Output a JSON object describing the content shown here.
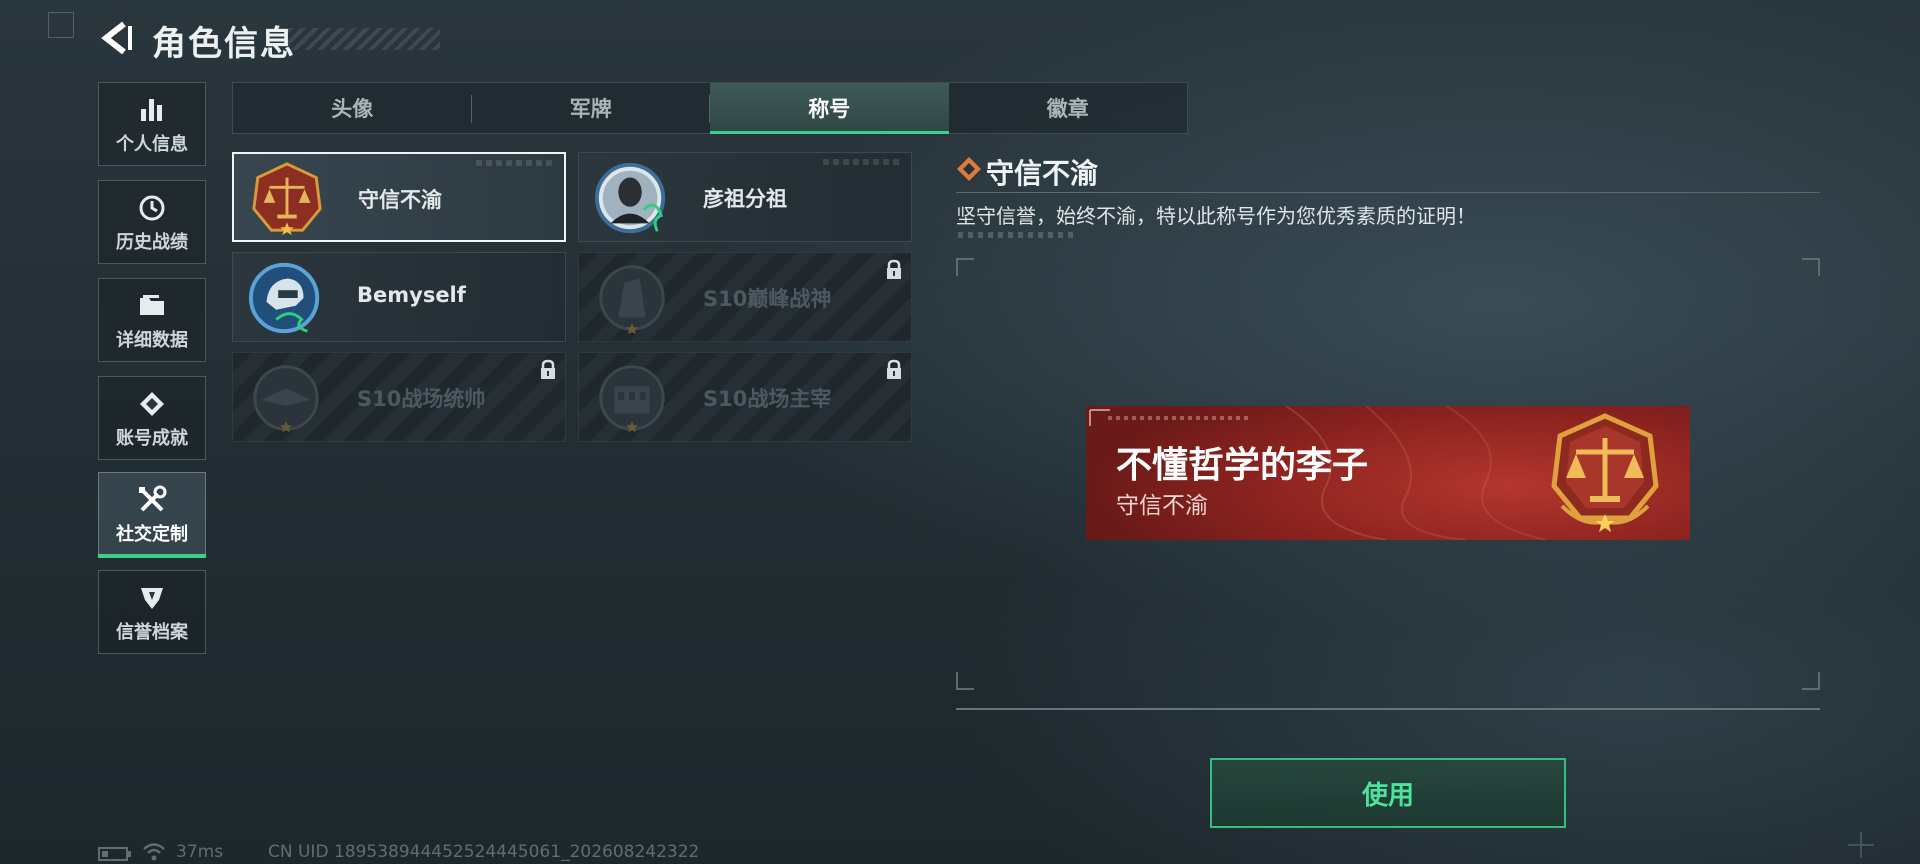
{
  "header": {
    "title": "角色信息"
  },
  "sidebar": {
    "items": [
      {
        "label": "个人信息",
        "icon": "bar-chart-icon"
      },
      {
        "label": "历史战绩",
        "icon": "clock-history-icon"
      },
      {
        "label": "详细数据",
        "icon": "folder-icon"
      },
      {
        "label": "账号成就",
        "icon": "achievement-icon"
      },
      {
        "label": "社交定制",
        "icon": "wrench-screwdriver-icon",
        "active": true
      },
      {
        "label": "信誉档案",
        "icon": "credit-shield-icon"
      }
    ]
  },
  "tabs": [
    {
      "label": "头像"
    },
    {
      "label": "军牌"
    },
    {
      "label": "称号",
      "active": true
    },
    {
      "label": "徽章"
    }
  ],
  "titles": [
    {
      "name": "守信不渝",
      "selected": true,
      "locked": false
    },
    {
      "name": "彦祖分祖",
      "selected": false,
      "locked": false
    },
    {
      "name": "Bemyself",
      "selected": false,
      "locked": false
    },
    {
      "name": "S10巅峰战神",
      "selected": false,
      "locked": true
    },
    {
      "name": "S10战场统帅",
      "selected": false,
      "locked": true
    },
    {
      "name": "S10战场主宰",
      "selected": false,
      "locked": true
    }
  ],
  "detail": {
    "title": "守信不渝",
    "description": "坚守信誉，始终不渝，特以此称号作为您优秀素质的证明！",
    "banner": {
      "player_name": "不懂哲学的李子",
      "title": "守信不渝"
    }
  },
  "actions": {
    "use_label": "使用"
  },
  "status": {
    "ping": "37ms",
    "uid": "CN UID 1895389444525244450​61_202608242322"
  },
  "colors": {
    "accent": "#3ad08a",
    "banner_red": "#a32d27",
    "emblem_gold": "#d89a3a"
  }
}
